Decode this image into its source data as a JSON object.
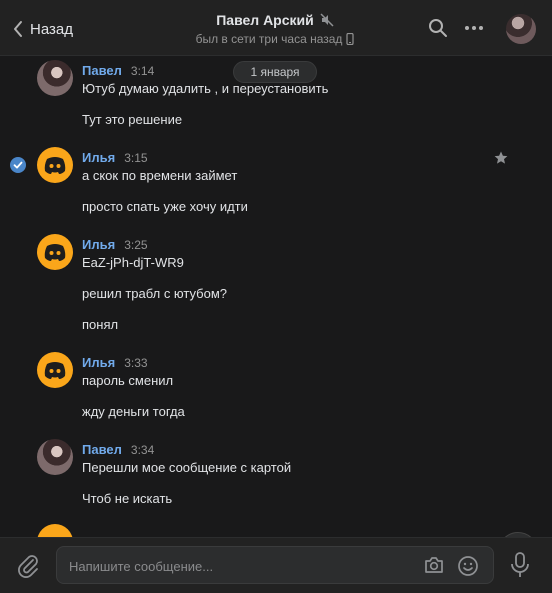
{
  "header": {
    "back_label": "Назад",
    "title": "Павел Арский",
    "status": "был в сети три часа назад"
  },
  "date_divider": "1 января",
  "messages": [
    {
      "author": "Павел",
      "time": "3:14",
      "lines": [
        "Ютуб думаю удалить , и переустановить",
        "Тут это решение"
      ]
    },
    {
      "author": "Илья",
      "time": "3:15",
      "lines": [
        "а скок по времени займет",
        "просто спать уже хочу идти"
      ]
    },
    {
      "author": "Илья",
      "time": "3:25",
      "lines": [
        "EaZ-jPh-djT-WR9",
        "решил трабл с ютубом?",
        "понял"
      ]
    },
    {
      "author": "Илья",
      "time": "3:33",
      "lines": [
        "пароль сменил",
        "жду деньги тогда"
      ]
    },
    {
      "author": "Павел",
      "time": "3:34",
      "lines": [
        "Перешли мое сообщение с картой",
        "Чтоб не искать"
      ]
    }
  ],
  "composer": {
    "placeholder": "Напишите сообщение..."
  },
  "colors": {
    "background": "#19191a",
    "panel": "#222222",
    "accent": "#71aaeb",
    "discord_avatar": "#faa61a"
  },
  "icons": [
    "chevron-left-icon",
    "muted-icon",
    "phone-icon",
    "search-icon",
    "more-icon",
    "check-icon",
    "star-icon",
    "chevron-down-icon",
    "paperclip-icon",
    "camera-icon",
    "smile-icon",
    "mic-icon"
  ]
}
